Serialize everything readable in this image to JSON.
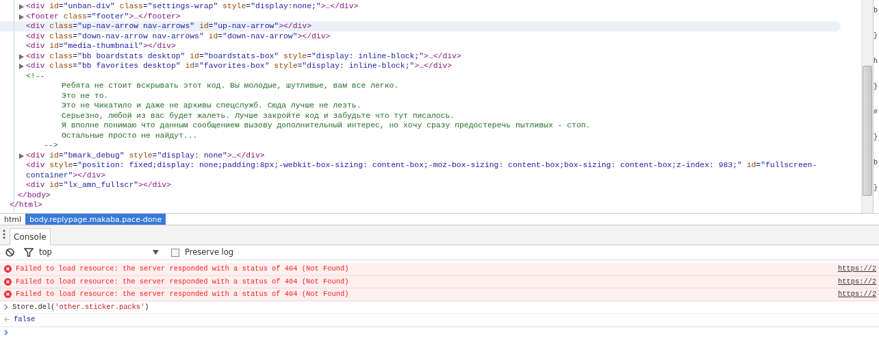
{
  "elements": {
    "root": {
      "closing": [
        {
          "kind": "tag",
          "text": "</html>"
        }
      ],
      "children": [
        {
          "closing": [
            {
              "kind": "tag",
              "text": "</body>"
            }
          ],
          "children": [
            {
              "kind": "node",
              "expandable": true,
              "highlighted": false,
              "tokens": [
                {
                  "kind": "tag",
                  "text": "<div"
                },
                {
                  "kind": "attr",
                  "text": " id"
                },
                {
                  "kind": "value",
                  "text": "=\"unban-div\""
                },
                {
                  "kind": "attr",
                  "text": " class"
                },
                {
                  "kind": "value",
                  "text": "=\"settings-wrap\""
                },
                {
                  "kind": "attr",
                  "text": " style"
                },
                {
                  "kind": "value",
                  "text": "=\"display:none;\""
                },
                {
                  "kind": "tag",
                  "text": ">…</div>"
                }
              ]
            },
            {
              "kind": "node",
              "expandable": true,
              "highlighted": false,
              "tokens": [
                {
                  "kind": "tag",
                  "text": "<footer"
                },
                {
                  "kind": "attr",
                  "text": " class"
                },
                {
                  "kind": "value",
                  "text": "=\"footer\""
                },
                {
                  "kind": "tag",
                  "text": ">…</footer>"
                }
              ]
            },
            {
              "kind": "node",
              "expandable": false,
              "highlighted": true,
              "tokens": [
                {
                  "kind": "tag",
                  "text": "<div"
                },
                {
                  "kind": "attr",
                  "text": " class"
                },
                {
                  "kind": "value",
                  "text": "=\"up-nav-arrow nav-arrows\""
                },
                {
                  "kind": "attr",
                  "text": " id"
                },
                {
                  "kind": "value",
                  "text": "=\"up-nav-arrow\""
                },
                {
                  "kind": "tag",
                  "text": "></div>"
                }
              ]
            },
            {
              "kind": "node",
              "expandable": false,
              "highlighted": false,
              "tokens": [
                {
                  "kind": "tag",
                  "text": "<div"
                },
                {
                  "kind": "attr",
                  "text": " class"
                },
                {
                  "kind": "value",
                  "text": "=\"down-nav-arrow nav-arrows\""
                },
                {
                  "kind": "attr",
                  "text": " id"
                },
                {
                  "kind": "value",
                  "text": "=\"down-nav-arrow\""
                },
                {
                  "kind": "tag",
                  "text": "></div>"
                }
              ]
            },
            {
              "kind": "node",
              "expandable": false,
              "highlighted": false,
              "tokens": [
                {
                  "kind": "tag",
                  "text": "<div"
                },
                {
                  "kind": "attr",
                  "text": " id"
                },
                {
                  "kind": "value",
                  "text": "=\"media-thumbnail\""
                },
                {
                  "kind": "tag",
                  "text": "></div>"
                }
              ]
            },
            {
              "kind": "node",
              "expandable": true,
              "highlighted": false,
              "tokens": [
                {
                  "kind": "tag",
                  "text": "<div"
                },
                {
                  "kind": "attr",
                  "text": " class"
                },
                {
                  "kind": "value",
                  "text": "=\"bb boardstats desktop\""
                },
                {
                  "kind": "attr",
                  "text": " id"
                },
                {
                  "kind": "value",
                  "text": "=\"boardstats-box\""
                },
                {
                  "kind": "attr",
                  "text": " style"
                },
                {
                  "kind": "value",
                  "text": "=\"display: inline-block;\""
                },
                {
                  "kind": "tag",
                  "text": ">…</div>"
                }
              ]
            },
            {
              "kind": "node",
              "expandable": true,
              "highlighted": false,
              "tokens": [
                {
                  "kind": "tag",
                  "text": "<div"
                },
                {
                  "kind": "attr",
                  "text": " class"
                },
                {
                  "kind": "value",
                  "text": "=\"bb favorites desktop\""
                },
                {
                  "kind": "attr",
                  "text": " id"
                },
                {
                  "kind": "value",
                  "text": "=\"favorites-box\""
                },
                {
                  "kind": "attr",
                  "text": " style"
                },
                {
                  "kind": "value",
                  "text": "=\"display: inline-block;\""
                },
                {
                  "kind": "tag",
                  "text": ">…</div>"
                }
              ]
            },
            {
              "kind": "comment",
              "open": "<!--",
              "close": "-->",
              "lines": [
                "Ребята не стоит вскрывать этот код. Вы молодые, шутливые, вам все легко.",
                "Это не то.",
                "Это не Чикатило и даже не архивы спецслужб. Сюда лучше не лезть.",
                "Серьезно, любой из вас будет жалеть. Лучше закройте код и забудьте что тут писалось.",
                "Я вполне понимаю что данным сообщением вызову дополнительный интерес, но хочу сразу предостеречь пытливых - стоп.",
                "Остальные просто не найдут..."
              ]
            },
            {
              "kind": "node",
              "expandable": true,
              "highlighted": false,
              "tokens": [
                {
                  "kind": "tag",
                  "text": "<div"
                },
                {
                  "kind": "attr",
                  "text": " id"
                },
                {
                  "kind": "value",
                  "text": "=\"bmark_debug\""
                },
                {
                  "kind": "attr",
                  "text": " style"
                },
                {
                  "kind": "value",
                  "text": "=\"display: none\""
                },
                {
                  "kind": "tag",
                  "text": ">…</div>"
                }
              ]
            },
            {
              "kind": "node",
              "expandable": false,
              "highlighted": false,
              "tokens": [
                {
                  "kind": "tag",
                  "text": "<div"
                },
                {
                  "kind": "attr",
                  "text": " style"
                },
                {
                  "kind": "value",
                  "text": "=\"position: fixed;display: none;padding:8px;-webkit-box-sizing: content-box;-moz-box-sizing: content-box;box-sizing: content-box;z-index: 983;\""
                },
                {
                  "kind": "attr",
                  "text": " id"
                },
                {
                  "kind": "value",
                  "text": "=\"fullscreen-container\""
                },
                {
                  "kind": "tag",
                  "text": "></div>"
                }
              ]
            },
            {
              "kind": "node",
              "expandable": false,
              "highlighted": false,
              "tokens": [
                {
                  "kind": "tag",
                  "text": "<div"
                },
                {
                  "kind": "attr",
                  "text": " id"
                },
                {
                  "kind": "value",
                  "text": "=\"lx_amn_fullscr\""
                },
                {
                  "kind": "tag",
                  "text": "></div>"
                }
              ]
            }
          ]
        }
      ]
    }
  },
  "styles_pane": [
    "b",
    "}",
    "h",
    "}",
    "#",
    "}",
    "b",
    "}"
  ],
  "breadcrumbs": [
    {
      "label": "html",
      "selected": false
    },
    {
      "label": "body.replypage.makaba.pace-done",
      "selected": true
    }
  ],
  "drawer_tabs": [
    {
      "label": "Console",
      "selected": true
    }
  ],
  "console_toolbar": {
    "context": "top",
    "preserve_log": {
      "label": "Preserve log",
      "checked": false
    }
  },
  "messages": [
    {
      "kind": "error",
      "text": "Failed to load resource: the server responded with a status of 404 (Not Found)",
      "source": "https://2"
    },
    {
      "kind": "error",
      "text": "Failed to load resource: the server responded with a status of 404 (Not Found)",
      "source": "https://2"
    },
    {
      "kind": "error",
      "text": "Failed to load resource: the server responded with a status of 404 (Not Found)",
      "source": "https://2"
    },
    {
      "kind": "input",
      "tokens": [
        {
          "kind": "code",
          "text": "Store.del("
        },
        {
          "kind": "string",
          "text": "'other.sticker.packs'"
        },
        {
          "kind": "code",
          "text": ")"
        }
      ]
    },
    {
      "kind": "result",
      "text": "false"
    }
  ]
}
